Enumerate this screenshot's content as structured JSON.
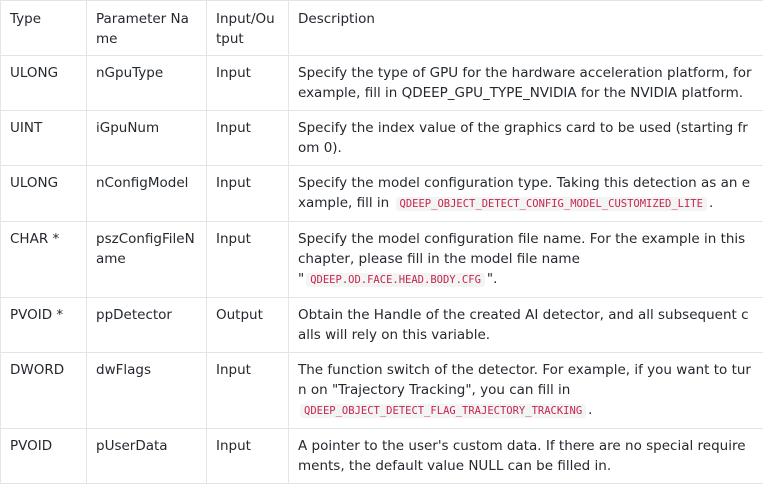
{
  "table": {
    "headers": [
      "Type",
      "Parameter Name",
      "Input/Output",
      "Description"
    ],
    "rows": [
      {
        "type": "ULONG",
        "name": "nGpuType",
        "io": "Input",
        "desc": [
          {
            "t": "Specify the type of GPU for the hardware acceleration platform, for example, fill in QDEEP_GPU_TYPE_NVIDIA for the NVIDIA platform."
          }
        ]
      },
      {
        "type": "UINT",
        "name": "iGpuNum",
        "io": "Input",
        "desc": [
          {
            "t": "Specify the index value of the graphics card to be used (starting from 0)."
          }
        ]
      },
      {
        "type": "ULONG",
        "name": "nConfigModel",
        "io": "Input",
        "desc": [
          {
            "t": "Specify the model configuration type. Taking this detection as an example, fill in "
          },
          {
            "code": "QDEEP_OBJECT_DETECT_CONFIG_MODEL_CUSTOMIZED_LITE"
          },
          {
            "t": "."
          }
        ]
      },
      {
        "type": "CHAR *",
        "name": "pszConfigFileName",
        "io": "Input",
        "desc": [
          {
            "t": "Specify the model configuration file name. For the example in this chapter, please fill in the model file name \""
          },
          {
            "code": "QDEEP.OD.FACE.HEAD.BODY.CFG"
          },
          {
            "t": "\"."
          }
        ]
      },
      {
        "type": "PVOID *",
        "name": "ppDetector",
        "io": "Output",
        "desc": [
          {
            "t": "Obtain the Handle of the created AI detector, and all subsequent calls will rely on this variable."
          }
        ]
      },
      {
        "type": "DWORD",
        "name": "dwFlags",
        "io": "Input",
        "desc": [
          {
            "t": "The function switch of the detector. For example, if you want to turn on \"Trajectory Tracking\", you can fill in "
          },
          {
            "code": "QDEEP_OBJECT_DETECT_FLAG_TRAJECTORY_TRACKING"
          },
          {
            "t": "."
          }
        ]
      },
      {
        "type": "PVOID",
        "name": "pUserData",
        "io": "Input",
        "desc": [
          {
            "t": "A pointer to the user's custom data. If there are no special requirements, the default value NULL can be filled in."
          }
        ]
      }
    ]
  }
}
